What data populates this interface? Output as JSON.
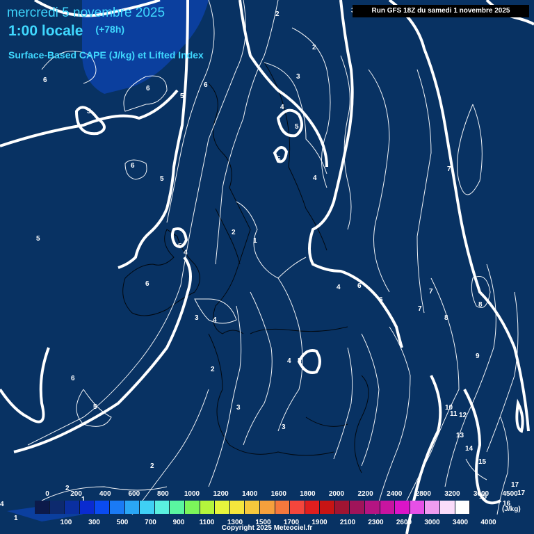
{
  "header": {
    "date_line": "mercredi 5 novembre 2025",
    "time_line": "1:00 locale",
    "lead_time": "(+78h)",
    "parameter": "Surface-Based CAPE (J/kg) et Lifted Index",
    "run_info": "Run GFS 18Z du samedi 1 novembre 2025"
  },
  "legend": {
    "unit": "(J/kg)",
    "top_ticks": [
      "0",
      "200",
      "400",
      "600",
      "800",
      "1000",
      "1200",
      "1400",
      "1600",
      "1800",
      "2000",
      "2200",
      "2400",
      "2800",
      "3200",
      "3600",
      "4500"
    ],
    "bottom_ticks": [
      "100",
      "300",
      "500",
      "700",
      "900",
      "1100",
      "1300",
      "1500",
      "1700",
      "1900",
      "2100",
      "2300",
      "2600",
      "3000",
      "3400",
      "4000"
    ],
    "colors": [
      "#0c1a4a",
      "#0d2a6e",
      "#0a2fa0",
      "#0a2bd0",
      "#0a4bf0",
      "#1a7af5",
      "#2aa6f5",
      "#3fd0f5",
      "#5af0e0",
      "#5af5a0",
      "#7cf55a",
      "#b4f53c",
      "#e6f53c",
      "#f5e63c",
      "#f5c83c",
      "#f5a03c",
      "#f5783c",
      "#f5463c",
      "#e01e1e",
      "#c81414",
      "#a01432",
      "#a0145a",
      "#b41482",
      "#c814a0",
      "#dc14c8",
      "#e650e6",
      "#f09cf0",
      "#fadcfa",
      "#ffffff"
    ]
  },
  "copyright": "Copyright 2025 Meteociel.fr",
  "map": {
    "lifted_index_labels": [
      "2",
      "2",
      "3",
      "4",
      "5",
      "5",
      "5",
      "5",
      "6",
      "6",
      "6",
      "6",
      "6",
      "5",
      "5",
      "4",
      "4",
      "2",
      "1",
      "5",
      "4",
      "6",
      "3",
      "4",
      "4",
      "5",
      "2",
      "6",
      "5",
      "3",
      "3",
      "2",
      "2",
      "7",
      "7",
      "7",
      "6",
      "5",
      "8",
      "8",
      "9",
      "10",
      "11",
      "12",
      "13",
      "14",
      "15",
      "15",
      "16",
      "17",
      "17",
      "1",
      "4",
      "1",
      "3"
    ]
  }
}
